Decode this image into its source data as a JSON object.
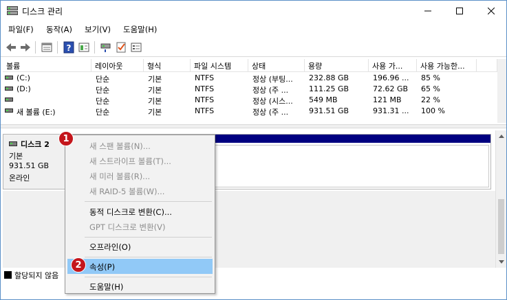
{
  "window": {
    "title": "디스크 관리"
  },
  "menu": [
    "파일(F)",
    "동작(A)",
    "보기(V)",
    "도움말(H)"
  ],
  "toolbar_icons": [
    "back-icon",
    "forward-icon",
    "properties-icon",
    "help-icon",
    "view-icon",
    "connect-icon",
    "check-icon",
    "list-icon"
  ],
  "columns": [
    "볼륨",
    "레이아웃",
    "형식",
    "파일 시스템",
    "상태",
    "용량",
    "사용 가...",
    "사용 가능한..."
  ],
  "volumes": [
    [
      "(C:)",
      "단순",
      "기본",
      "NTFS",
      "정상 (부팅...",
      "232.88 GB",
      "196.96 ...",
      "85 %"
    ],
    [
      "(D:)",
      "단순",
      "기본",
      "NTFS",
      "정상 (주 ...",
      "111.25 GB",
      "72.62 GB",
      "65 %"
    ],
    [
      "",
      "단순",
      "기본",
      "NTFS",
      "정상 (시스...",
      "549 MB",
      "121 MB",
      "22 %"
    ],
    [
      "새 볼륨 (E:)",
      "단순",
      "기본",
      "NTFS",
      "정상 (주 ...",
      "931.51 GB",
      "931.31 ...",
      "100 %"
    ]
  ],
  "disk": {
    "name": "디스크 2",
    "type": "기본",
    "size": "931.51 GB",
    "status": "온라인"
  },
  "legend": {
    "unallocated": "할당되지 않음"
  },
  "context_menu": {
    "new_spanned": "새 스팬 볼륨(N)...",
    "new_striped": "새 스트라이프 볼륨(T)...",
    "new_mirror": "새 미러 볼륨(R)...",
    "new_raid5": "새 RAID-5 볼륨(W)...",
    "convert_dynamic": "동적 디스크로 변환(C)...",
    "convert_gpt": "GPT 디스크로 변환(V)",
    "offline": "오프라인(O)",
    "properties": "속성(P)",
    "help": "도움말(H)"
  },
  "badges": {
    "b1": "1",
    "b2": "2"
  },
  "colors": {
    "partition_bar": "#000080",
    "menu_highlight": "#91c9f7",
    "badge": "#c4161c"
  }
}
